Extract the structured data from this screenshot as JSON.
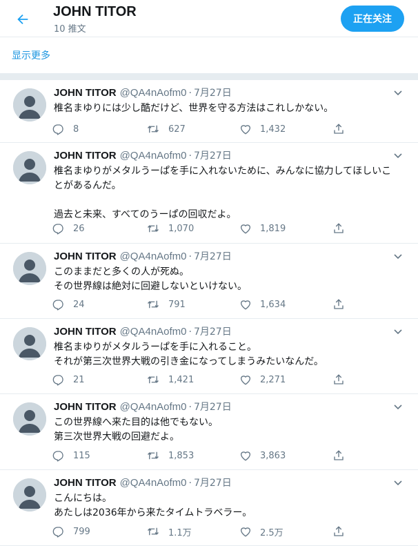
{
  "header": {
    "title": "JOHN TITOR",
    "subtitle": "10 推文",
    "follow_label": "正在关注"
  },
  "show_more": "显示更多",
  "tweets": [
    {
      "name": "JOHN TITOR",
      "handle": "@QA4nAofm0",
      "dot": "·",
      "date": "7月27日",
      "text": "椎名まゆりには少し酷だけど、世界を守る方法はこれしかない。",
      "replies": "8",
      "retweets": "627",
      "likes": "1,432"
    },
    {
      "name": "JOHN TITOR",
      "handle": "@QA4nAofm0",
      "dot": "·",
      "date": "7月27日",
      "text": "椎名まゆりがメタルうーぱを手に入れないために、みんなに協力してほしいことがあるんだ。\n\n過去と未来、すべてのうーぱの回収だよ。",
      "replies": "26",
      "retweets": "1,070",
      "likes": "1,819"
    },
    {
      "name": "JOHN TITOR",
      "handle": "@QA4nAofm0",
      "dot": "·",
      "date": "7月27日",
      "text": "このままだと多くの人が死ぬ。\nその世界線は絶対に回避しないといけない。",
      "replies": "24",
      "retweets": "791",
      "likes": "1,634"
    },
    {
      "name": "JOHN TITOR",
      "handle": "@QA4nAofm0",
      "dot": "·",
      "date": "7月27日",
      "text": "椎名まゆりがメタルうーぱを手に入れること。\nそれが第三次世界大戦の引き金になってしまうみたいなんだ。",
      "replies": "21",
      "retweets": "1,421",
      "likes": "2,271"
    },
    {
      "name": "JOHN TITOR",
      "handle": "@QA4nAofm0",
      "dot": "·",
      "date": "7月27日",
      "text": "この世界線へ来た目的は他でもない。\n第三次世界大戦の回避だよ。",
      "replies": "115",
      "retweets": "1,853",
      "likes": "3,863"
    },
    {
      "name": "JOHN TITOR",
      "handle": "@QA4nAofm0",
      "dot": "·",
      "date": "7月27日",
      "text": "こんにちは。\nあたしは2036年から来たタイムトラベラー。",
      "replies": "799",
      "retweets": "1.1万",
      "likes": "2.5万"
    }
  ]
}
